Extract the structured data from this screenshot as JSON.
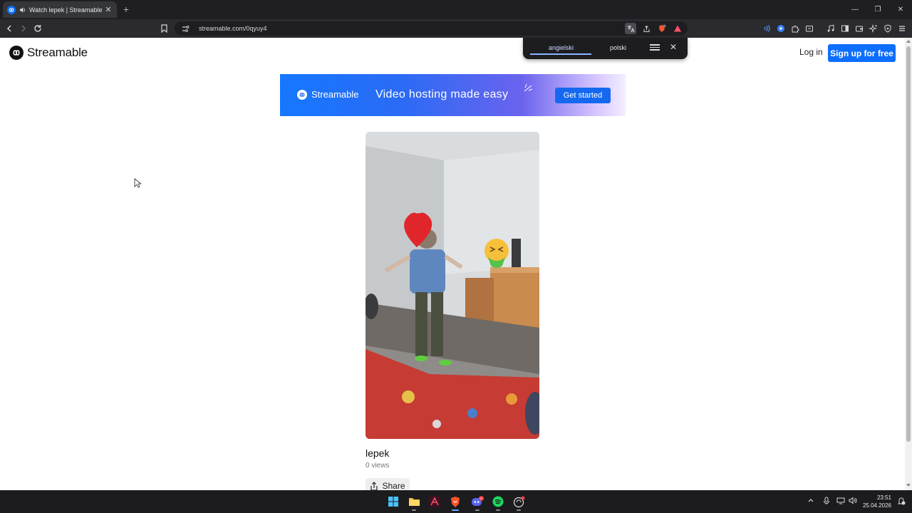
{
  "browser": {
    "tab_title": "Watch lepek | Streamable",
    "new_tab_symbol": "+",
    "url": "streamable.com/0qyuy4",
    "window_controls": {
      "minimize": "—",
      "maximize": "❐",
      "close": "✕"
    }
  },
  "translate_popup": {
    "source_language": "angielski",
    "target_language": "polski",
    "selected": "angielski"
  },
  "site": {
    "brand": "Streamable",
    "login_label": "Log in",
    "signup_label": "Sign up for free",
    "brand_color": "#0d6efd"
  },
  "banner": {
    "brand": "Streamable",
    "tagline": "Video hosting made easy",
    "cta_label": "Get started"
  },
  "video": {
    "title": "lepek",
    "views": "0 views",
    "share_label": "Share"
  },
  "taskbar": {
    "time": "23:51",
    "date": "25.04.2026",
    "discord_badge": "9+",
    "apps": [
      "start-icon",
      "file-explorer-icon",
      "affinity-icon",
      "brave-icon",
      "discord-icon",
      "spotify-icon",
      "chatgpt-icon"
    ]
  }
}
